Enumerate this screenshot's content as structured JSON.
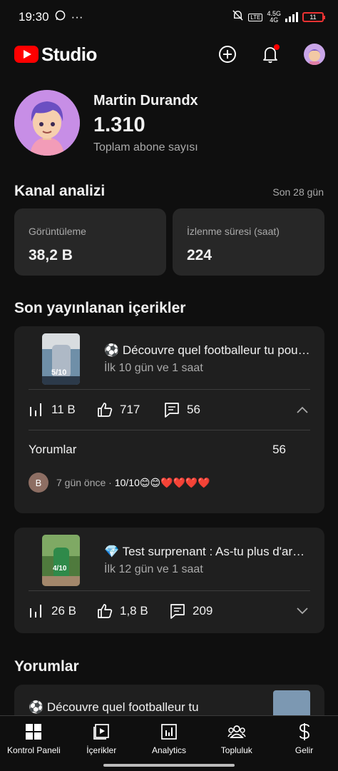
{
  "status_bar": {
    "time": "19:30",
    "dots": "···",
    "network_top": "4.5G",
    "network_bottom": "4G",
    "battery": "11"
  },
  "header": {
    "logo_text": "Studio",
    "icons": [
      "create-icon",
      "bell-icon",
      "account-avatar"
    ]
  },
  "profile": {
    "channel_name": "Martin Durandx",
    "subscriber_count": "1.310",
    "subscriber_label": "Toplam abone sayısı"
  },
  "analytics": {
    "title": "Kanal analizi",
    "period": "Son 28 gün",
    "metrics": [
      {
        "label": "Görüntüleme",
        "value": "38,2 B"
      },
      {
        "label": "İzlenme süresi (saat)",
        "value": "224"
      }
    ]
  },
  "recent": {
    "title": "Son yayınlanan içerikler",
    "videos": [
      {
        "title": "⚽ Découvre quel footballeur tu pourrais être",
        "age": "İlk 10 gün ve 1 saat",
        "thumb_label": "5/10",
        "views": "11 B",
        "likes": "717",
        "comments": "56",
        "expanded": true,
        "comments_label": "Yorumlar",
        "comments_count": "56",
        "comment": {
          "avatar_letter": "B",
          "time": "7 gün önce ·",
          "text": "10/10😊😊❤️❤️❤️❤️"
        }
      },
      {
        "title": "💎 Test surprenant : As-tu plus d'argent",
        "age": "İlk 12 gün ve 1 saat",
        "thumb_label": "4/10",
        "views": "26 B",
        "likes": "1,8 B",
        "comments": "209",
        "expanded": false
      }
    ]
  },
  "comments_section": {
    "title": "Yorumlar",
    "preview_title": "⚽ Découvre quel footballeur tu"
  },
  "bottom_nav": [
    {
      "label": "Kontrol Paneli",
      "icon": "dashboard-icon"
    },
    {
      "label": "İçerikler",
      "icon": "content-icon"
    },
    {
      "label": "Analytics",
      "icon": "analytics-icon"
    },
    {
      "label": "Topluluk",
      "icon": "community-icon"
    },
    {
      "label": "Gelir",
      "icon": "earn-icon"
    }
  ],
  "colors": {
    "background": "#0f0f0f",
    "card": "#272727",
    "card_alt": "#1f1f1f",
    "brand_red": "#ff0000",
    "secondary_text": "#aaaaaa"
  }
}
